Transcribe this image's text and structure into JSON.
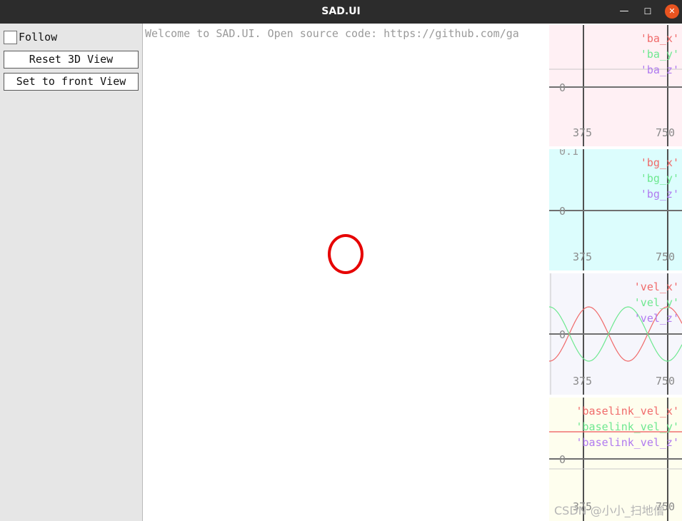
{
  "window": {
    "title": "SAD.UI",
    "minimize_glyph": "—",
    "maximize_glyph": "☐",
    "close_glyph": "✕",
    "close_color": "#e95420"
  },
  "sidebar": {
    "follow_label": "Follow",
    "follow_checked": false,
    "reset_button": "Reset 3D View",
    "front_button": "Set to front View"
  },
  "view3d": {
    "welcome_text": "Welcome to SAD.UI. Open source code: https://github.com/ga",
    "marker_color": "#e60000"
  },
  "plots": [
    {
      "background": "#fff0f4",
      "legend": [
        "'ba_x'",
        "'ba_y'",
        "'ba_z'"
      ],
      "y_tick": "0",
      "x_ticks": [
        "375",
        "750"
      ]
    },
    {
      "background": "#dcfdfd",
      "legend": [
        "'bg_x'",
        "'bg_y'",
        "'bg_z'"
      ],
      "y_tick": "0",
      "y_top_label": "0.1",
      "x_ticks": [
        "375",
        "750"
      ]
    },
    {
      "background": "#f6f6fc",
      "legend": [
        "'vel_x'",
        "'vel_y'",
        "'vel_z'"
      ],
      "y_tick": "0",
      "x_ticks": [
        "375",
        "750"
      ]
    },
    {
      "background": "#fefeee",
      "legend": [
        "'baselink_vel_x'",
        "'baselink_vel_y'",
        "'baselink_vel_z'"
      ],
      "y_tick": "0",
      "x_ticks": [
        "375",
        "750"
      ]
    }
  ],
  "series_colors": [
    "#f06a6a",
    "#6ee890",
    "#b07af0"
  ],
  "watermark": "CSDN @小小_扫地僧"
}
